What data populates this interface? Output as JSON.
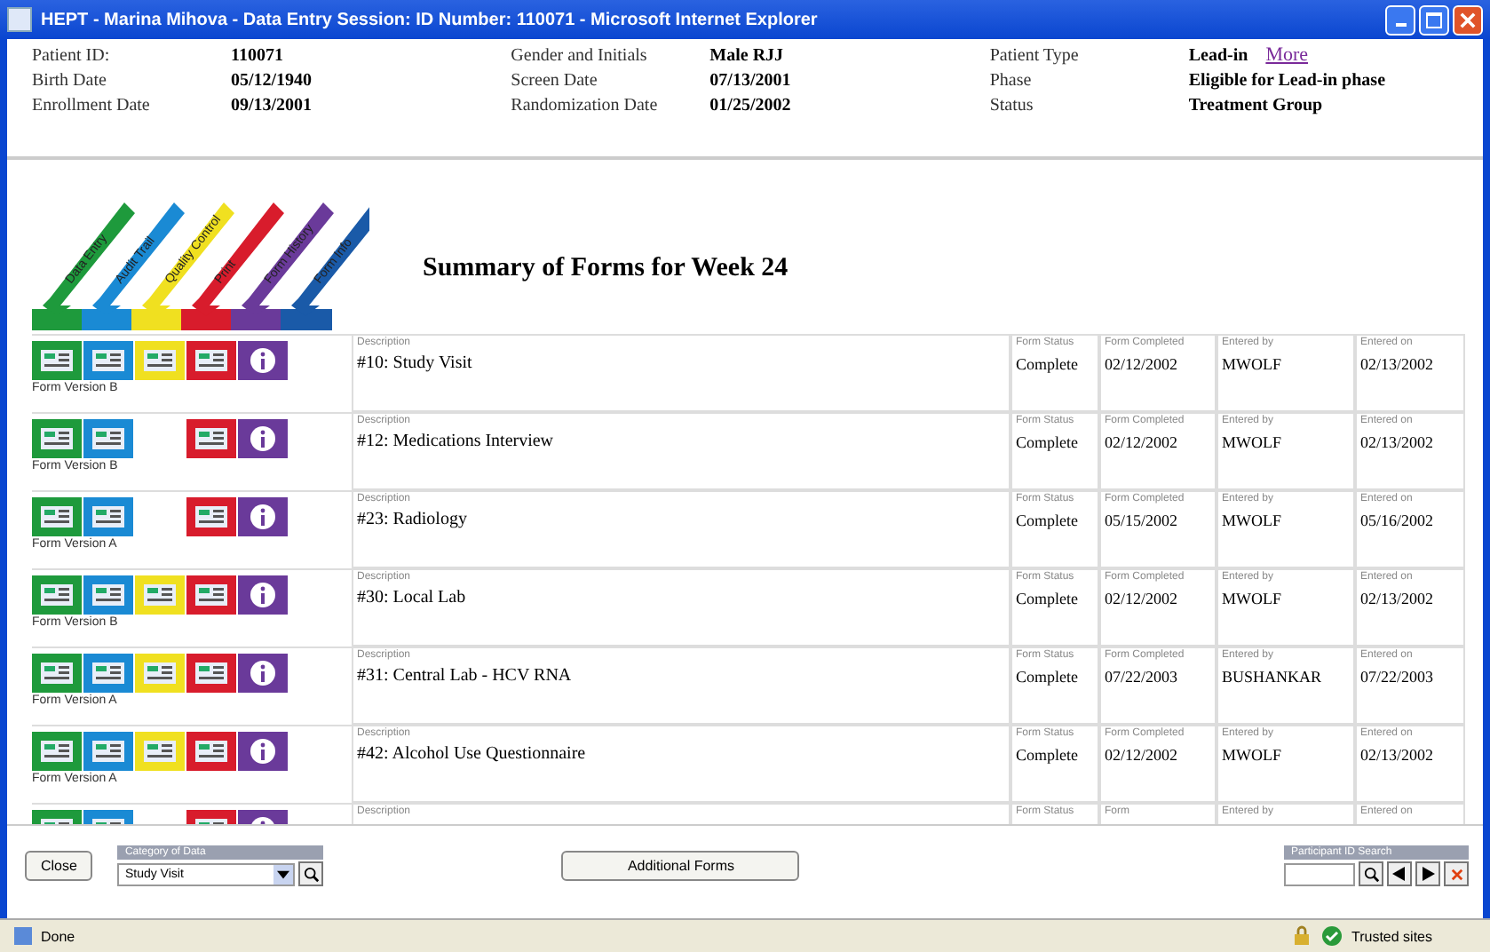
{
  "window": {
    "title": "HEPT - Marina Mihova - Data Entry Session: ID Number: 110071 - Microsoft Internet Explorer"
  },
  "patient": [
    {
      "label": "Patient ID:",
      "value": "110071"
    },
    {
      "label": "Birth Date",
      "value": "05/12/1940"
    },
    {
      "label": "Enrollment Date",
      "value": "09/13/2001"
    },
    {
      "label": "Gender and Initials",
      "value": "Male RJJ"
    },
    {
      "label": "Screen Date",
      "value": "07/13/2001"
    },
    {
      "label": "Randomization Date",
      "value": "01/25/2002"
    },
    {
      "label": "Patient Type",
      "value": "Lead-in",
      "link": "More"
    },
    {
      "label": "Phase",
      "value": "Eligible for Lead-in phase"
    },
    {
      "label": "Status",
      "value": "Treatment Group"
    }
  ],
  "columns": [
    {
      "label": "Data Entry",
      "color": "#1e9a3c"
    },
    {
      "label": "Audit Trail",
      "color": "#1a8ad4"
    },
    {
      "label": "Quality Control",
      "color": "#f0e020"
    },
    {
      "label": "Print",
      "color": "#d81c2c"
    },
    {
      "label": "Form History",
      "color": "#6a3a9a"
    },
    {
      "label": "Form Info",
      "color": "#1a5aa8"
    }
  ],
  "summary_title": "Summary of Forms for Week 24",
  "rows": [
    {
      "icons": [
        true,
        true,
        true,
        true,
        true
      ],
      "version": "Form Version B",
      "cells": [
        {
          "label": "Description",
          "value": "#10: Study Visit"
        },
        {
          "label": "Form Status",
          "value": "Complete"
        },
        {
          "label": "Form Completed",
          "value": "02/12/2002"
        },
        {
          "label": "Entered by",
          "value": "MWOLF"
        },
        {
          "label": "Entered on",
          "value": "02/13/2002"
        }
      ]
    },
    {
      "icons": [
        true,
        true,
        false,
        true,
        true
      ],
      "version": "Form Version B",
      "cells": [
        {
          "label": "Description",
          "value": "#12: Medications Interview"
        },
        {
          "label": "Form Status",
          "value": "Complete"
        },
        {
          "label": "Form Completed",
          "value": "02/12/2002"
        },
        {
          "label": "Entered by",
          "value": "MWOLF"
        },
        {
          "label": "Entered on",
          "value": "02/13/2002"
        }
      ]
    },
    {
      "icons": [
        true,
        true,
        false,
        true,
        true
      ],
      "version": "Form Version A",
      "cells": [
        {
          "label": "Description",
          "value": "#23: Radiology"
        },
        {
          "label": "Form Status",
          "value": "Complete"
        },
        {
          "label": "Form Completed",
          "value": "05/15/2002"
        },
        {
          "label": "Entered by",
          "value": "MWOLF"
        },
        {
          "label": "Entered on",
          "value": "05/16/2002"
        }
      ]
    },
    {
      "icons": [
        true,
        true,
        true,
        true,
        true
      ],
      "version": "Form Version B",
      "cells": [
        {
          "label": "Description",
          "value": "#30: Local Lab"
        },
        {
          "label": "Form Status",
          "value": "Complete"
        },
        {
          "label": "Form Completed",
          "value": "02/12/2002"
        },
        {
          "label": "Entered by",
          "value": "MWOLF"
        },
        {
          "label": "Entered on",
          "value": "02/13/2002"
        }
      ]
    },
    {
      "icons": [
        true,
        true,
        true,
        true,
        true
      ],
      "version": "Form Version A",
      "cells": [
        {
          "label": "Description",
          "value": "#31: Central Lab - HCV RNA"
        },
        {
          "label": "Form Status",
          "value": "Complete"
        },
        {
          "label": "Form Completed",
          "value": "07/22/2003"
        },
        {
          "label": "Entered by",
          "value": "BUSHANKAR"
        },
        {
          "label": "Entered on",
          "value": "07/22/2003"
        }
      ]
    },
    {
      "icons": [
        true,
        true,
        true,
        true,
        true
      ],
      "version": "Form Version A",
      "cells": [
        {
          "label": "Description",
          "value": "#42: Alcohol Use Questionnaire"
        },
        {
          "label": "Form Status",
          "value": "Complete"
        },
        {
          "label": "Form Completed",
          "value": "02/12/2002"
        },
        {
          "label": "Entered by",
          "value": "MWOLF"
        },
        {
          "label": "Entered on",
          "value": "02/13/2002"
        }
      ]
    },
    {
      "icons": [
        true,
        true,
        false,
        true,
        true
      ],
      "cells": [
        {
          "label": "Description"
        },
        {
          "label": "Form Status"
        },
        {
          "label": "Form"
        },
        {
          "label": "Entered by"
        },
        {
          "label": "Entered on"
        }
      ]
    }
  ],
  "toolbar": {
    "close": "Close",
    "category_label": "Category of Data",
    "category_value": "Study Visit",
    "additional": "Additional Forms",
    "search_label": "Participant ID Search"
  },
  "status_bar": {
    "text": "Done",
    "zone": "Trusted sites"
  }
}
